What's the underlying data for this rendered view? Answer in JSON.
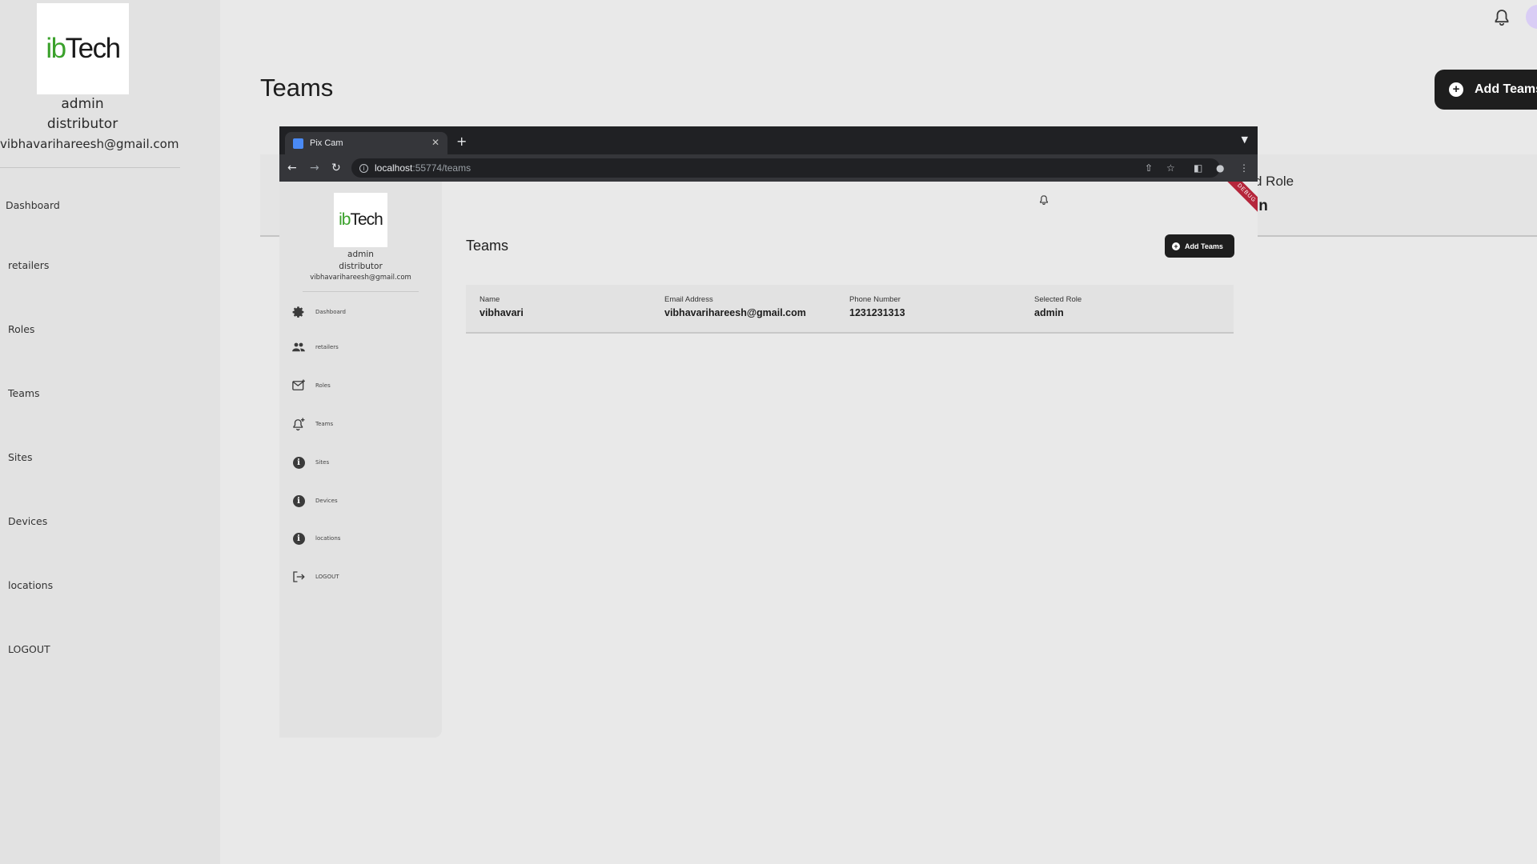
{
  "app": {
    "logo_text_a": "ib",
    "logo_text_b": "Tech",
    "user": {
      "role_primary": "admin",
      "role_secondary": "distributor",
      "email": "vibhavarihareesh@gmail.com"
    },
    "nav": [
      {
        "label": "Dashboard"
      },
      {
        "label": "retailers"
      },
      {
        "label": "Roles"
      },
      {
        "label": "Teams"
      },
      {
        "label": "Sites"
      },
      {
        "label": "Devices"
      },
      {
        "label": "locations"
      },
      {
        "label": "LOGOUT"
      }
    ],
    "page_title": "Teams",
    "add_button": "Add Teams",
    "table_partial": {
      "header": "d Role",
      "value": "in"
    }
  },
  "browser": {
    "tab_title": "Pix Cam",
    "url_host": "localhost",
    "url_path": ":55774/teams",
    "debug_label": "DEBUG",
    "inner": {
      "logo_text_a": "ib",
      "logo_text_b": "Tech",
      "user": {
        "role_primary": "admin",
        "role_secondary": "distributor",
        "email": "vibhavarihareesh@gmail.com"
      },
      "nav": [
        {
          "label": "Dashboard",
          "icon": "gear-icon"
        },
        {
          "label": "retailers",
          "icon": "people-icon"
        },
        {
          "label": "Roles",
          "icon": "mail-icon"
        },
        {
          "label": "Teams",
          "icon": "bell-add-icon"
        },
        {
          "label": "Sites",
          "icon": "info-icon"
        },
        {
          "label": "Devices",
          "icon": "info-icon"
        },
        {
          "label": "locations",
          "icon": "info-icon"
        },
        {
          "label": "LOGOUT",
          "icon": "logout-icon"
        }
      ],
      "page_title": "Teams",
      "add_button": "Add Teams",
      "table": {
        "columns": [
          "Name",
          "Email Address",
          "Phone Number",
          "Selected Role"
        ],
        "rows": [
          [
            "vibhavari",
            "vibhavarihareesh@gmail.com",
            "1231231313",
            "admin"
          ]
        ]
      }
    }
  },
  "colors": {
    "button_dark": "#1e1e1e",
    "sidebar_bg": "#e2e2e2",
    "page_bg": "#e9e9e9",
    "logo_green": "#3aa12b",
    "debug_red": "#b5263b"
  }
}
